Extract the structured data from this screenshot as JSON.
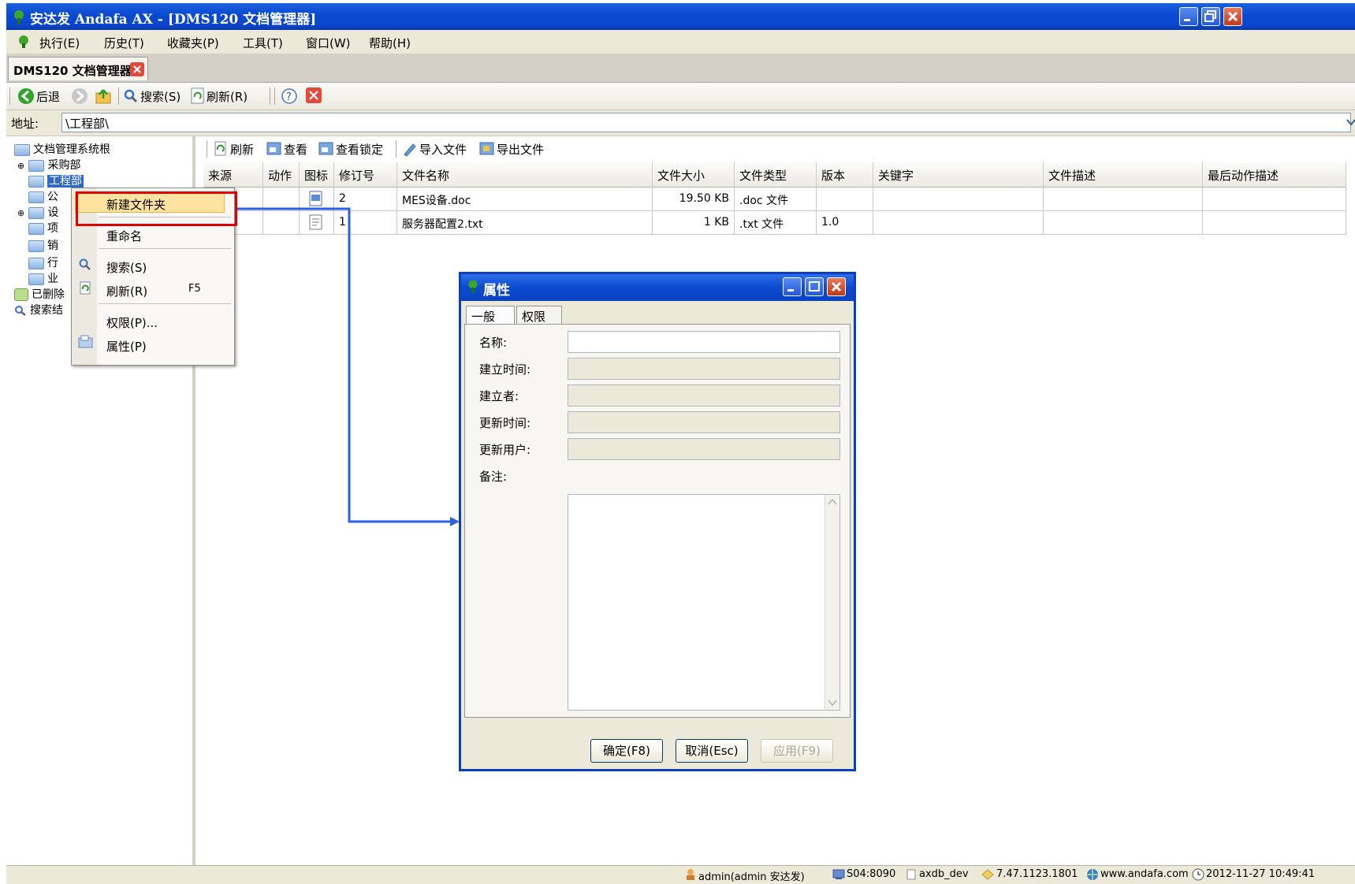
{
  "window": {
    "title": "安达发 Andafa AX - [DMS120 文档管理器]"
  },
  "menu": [
    "执行(E)",
    "历史(T)",
    "收藏夹(P)",
    "工具(T)",
    "窗口(W)",
    "帮助(H)"
  ],
  "doc_tab": {
    "label": "DMS120 文档管理器"
  },
  "toolbar": {
    "back": "后退",
    "search": "搜索(S)",
    "refresh": "刷新(R)"
  },
  "address": {
    "label": "地址:",
    "value": "\\工程部\\"
  },
  "tree": {
    "root": "文档管理系统根",
    "items": [
      "采购部",
      "工程部",
      "公",
      "设",
      "项",
      "销",
      "行",
      "业"
    ],
    "deleted": "已删除",
    "search": "搜索结"
  },
  "right_toolbar": [
    "刷新",
    "查看",
    "查看锁定",
    "导入文件",
    "导出文件"
  ],
  "table": {
    "columns": [
      "来源",
      "动作",
      "图标",
      "修订号",
      "文件名称",
      "文件大小",
      "文件类型",
      "版本",
      "关键字",
      "文件描述",
      "最后动作描述"
    ],
    "rows": [
      {
        "rev": "2",
        "name": "MES设备.doc",
        "size": "19.50 KB",
        "type": ".doc 文件",
        "version": ""
      },
      {
        "rev": "1",
        "name": "服务器配置2.txt",
        "size": "1 KB",
        "type": ".txt 文件",
        "version": "1.0"
      }
    ]
  },
  "context_menu": {
    "items": [
      "新建文件夹",
      "重命名",
      "搜索(S)",
      "刷新(R)",
      "权限(P)...",
      "属性(P)"
    ],
    "refresh_shortcut": "F5"
  },
  "dialog": {
    "title": "属性",
    "tabs": [
      "一般",
      "权限"
    ],
    "fields": [
      "名称:",
      "建立时间:",
      "建立者:",
      "更新时间:",
      "更新用户:",
      "备注:"
    ],
    "buttons": {
      "ok": "确定(F8)",
      "cancel": "取消(Esc)",
      "apply": "应用(F9)"
    }
  },
  "status": {
    "user": "admin(admin 安达发)",
    "server": "S04:8090",
    "db": "axdb_dev",
    "version": "7.47.1123.1801",
    "website": "www.andafa.com",
    "datetime": "2012-11-27 10:49:41"
  },
  "colors": {
    "accent": "#0a46c8",
    "highlight_border": "#e00000",
    "connector": "#2b5fe6"
  }
}
